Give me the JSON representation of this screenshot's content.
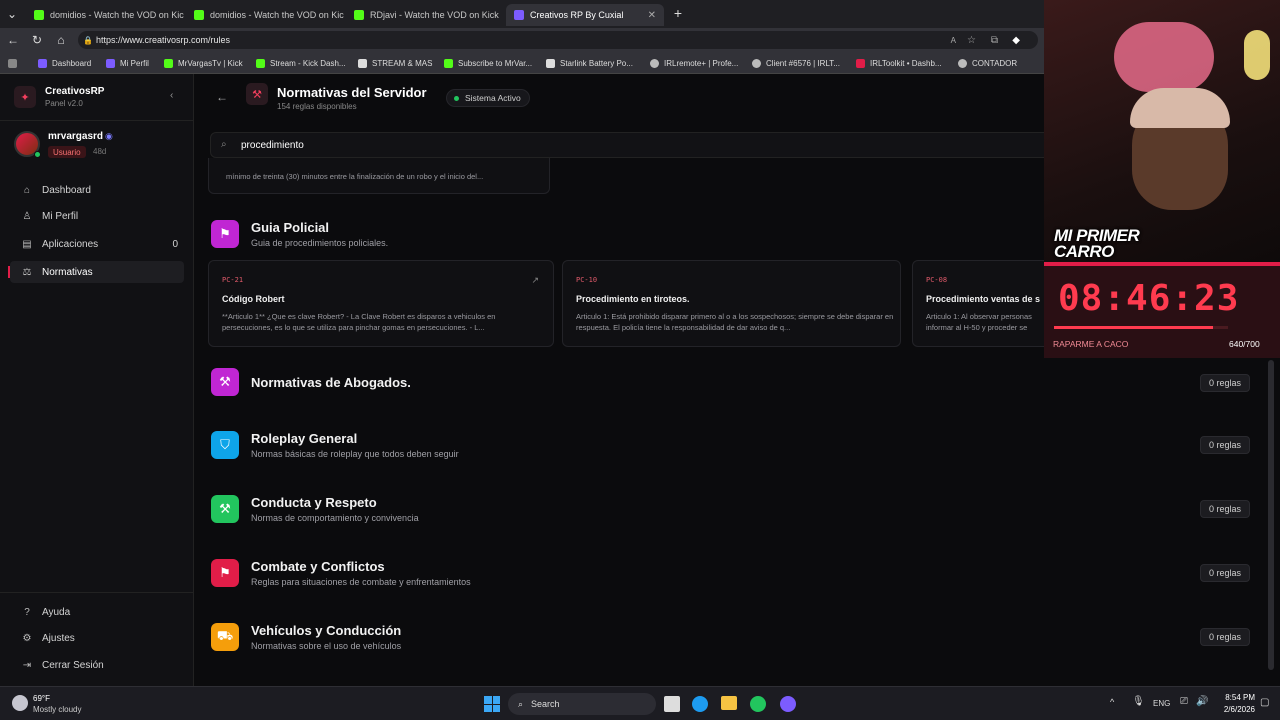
{
  "browser": {
    "tabs": [
      {
        "label": "domidios - Watch the VOD on Kick"
      },
      {
        "label": "domidios - Watch the VOD on Kick"
      },
      {
        "label": "RDjavi - Watch the VOD on Kick"
      },
      {
        "label": "Creativos RP By Cuxial"
      }
    ],
    "url": "https://www.creativosrp.com/rules",
    "bookmarks": [
      "Dashboard",
      "Mi Perfil",
      "MrVargasTv | Kick",
      "Stream - Kick Dash...",
      "STREAM & MAS",
      "Subscribe to MrVar...",
      "Starlink Battery Po...",
      "IRLremote+ | Profe...",
      "Client #6576 | IRLT...",
      "IRLToolkit • Dashb...",
      "CONTADOR"
    ]
  },
  "app": {
    "name": "CreativosRP",
    "version": "Panel v2.0",
    "user": {
      "name": "mrvargasrd",
      "role": "Usuario",
      "since": "48d"
    },
    "nav": [
      {
        "label": "Dashboard",
        "count": ""
      },
      {
        "label": "Mi Perfil",
        "count": ""
      },
      {
        "label": "Aplicaciones",
        "count": "0"
      },
      {
        "label": "Normativas",
        "count": ""
      }
    ],
    "footer_nav": [
      {
        "label": "Ayuda"
      },
      {
        "label": "Ajustes"
      },
      {
        "label": "Cerrar Sesión"
      }
    ]
  },
  "header": {
    "title": "Normativas del Servidor",
    "subtitle": "154 reglas disponibles",
    "status": "Sistema Activo"
  },
  "search": {
    "value": "procedimiento"
  },
  "top_snippet": "mínimo de treinta (30) minutos entre la finalización de un robo y el inicio del...",
  "policia": {
    "title": "Guia Policial",
    "desc": "Guia de procedimientos policiales.",
    "cards": [
      {
        "code": "PC-21",
        "title": "Código Robert",
        "desc": "**Articulo 1** ¿Que es clave Robert? - La Clave Robert es disparos a vehiculos en persecuciones, es lo que se utiliza para pinchar gomas en persecuciones. - L..."
      },
      {
        "code": "PC-10",
        "title": "Procedimiento en tiroteos.",
        "desc": "Articulo 1: Está prohibido disparar primero al o a los sospechosos; siempre se debe disparar en respuesta. El policía tiene la responsabilidad de dar aviso de q..."
      },
      {
        "code": "PC-08",
        "title": "Procedimiento ventas de s",
        "desc": "Articulo 1: Al observar personas informar al H-50 y proceder se"
      }
    ]
  },
  "categories": [
    {
      "title": "Normativas de Abogados.",
      "desc": "",
      "count": "0 reglas",
      "color": "#c026d3"
    },
    {
      "title": "Roleplay General",
      "desc": "Normas básicas de roleplay que todos deben seguir",
      "count": "0 reglas",
      "color": "#0ea5e9"
    },
    {
      "title": "Conducta y Respeto",
      "desc": "Normas de comportamiento y convivencia",
      "count": "0 reglas",
      "color": "#22c55e"
    },
    {
      "title": "Combate y Conflictos",
      "desc": "Reglas para situaciones de combate y enfrentamientos",
      "count": "0 reglas",
      "color": "#e11d48"
    },
    {
      "title": "Vehículos y Conducción",
      "desc": "Normativas sobre el uso de vehículos",
      "count": "0 reglas",
      "color": "#f59e0b"
    }
  ],
  "overlay": {
    "banner": "MI PRIMER CARRO",
    "timer": "08:46:23",
    "goal_label": "RAPARME A CACO",
    "goal_value": "640/700",
    "goal_progress": 0.914
  },
  "taskbar": {
    "weather_temp": "69°F",
    "weather_desc": "Mostly cloudy",
    "search": "Search",
    "lang": "ENG",
    "time": "8:54 PM",
    "date": "2/6/2026"
  }
}
